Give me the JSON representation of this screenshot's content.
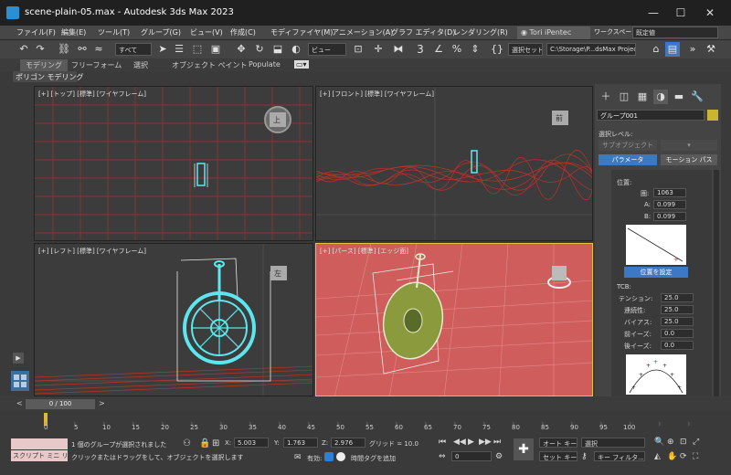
{
  "window": {
    "title": "scene-plain-05.max - Autodesk 3ds Max 2023",
    "min": "—",
    "max": "☐",
    "close": "✕"
  },
  "menu": {
    "items": [
      "ファイル(F)",
      "編集(E)",
      "ツール(T)",
      "グループ(G)",
      "ビュー(V)",
      "作成(C)",
      "モディファイヤ(M)",
      "アニメーション(A)",
      "グラフ エディタ(D)",
      "レンダリング(R)"
    ],
    "user": "Tori iPentec",
    "workspace_label": "ワークスペース:",
    "workspace_value": "既定値"
  },
  "toolbar": {
    "filter": "すべて",
    "view": "ビュー",
    "selset": "選択セット",
    "path": "C:\\Storage\\P...dsMax Project"
  },
  "ribbon": {
    "tabs": [
      "モデリング",
      "フリーフォーム",
      "選択",
      "オブジェクト ペイント",
      "Populate"
    ],
    "sub": "ポリゴン モデリング"
  },
  "viewports": {
    "top": "[+] [トップ] [標準] [ワイヤフレーム]",
    "front": "[+] [フロント] [標準] [ワイヤフレーム]",
    "left": "[+] [レフト] [標準] [ワイヤフレーム]",
    "persp": "[+] [パース] [標準] [エッジ面]",
    "cube_top": "上",
    "cube_front": "前",
    "cube_left": "左"
  },
  "cmd": {
    "object_name": "グループ001",
    "sel_level_label": "選択レベル:",
    "sub_object": "サブオブジェクト",
    "btn_param": "パラメータ",
    "btn_motion": "モーション パス",
    "pos_label": "位置:",
    "frame_label": "圏:",
    "frame_val": "1063",
    "a_label": "A:",
    "a_val": "0.099",
    "b_label": "B:",
    "b_val": "0.099",
    "set_pos": "位置を設定",
    "tcb_label": "TCB:",
    "tension_label": "テンション:",
    "tension": "25.0",
    "continuity_label": "連続性:",
    "continuity": "25.0",
    "bias_label": "バイアス:",
    "bias": "25.0",
    "ease_to_label": "前イーズ:",
    "ease_to": "0.0",
    "ease_from_label": "後イーズ:",
    "ease_from": "0.0"
  },
  "time": {
    "slider": "0 / 100",
    "ticks": [
      "0",
      "5",
      "10",
      "15",
      "20",
      "25",
      "30",
      "35",
      "40",
      "45",
      "50",
      "55",
      "60",
      "65",
      "70",
      "75",
      "80",
      "85",
      "90",
      "95",
      "100"
    ]
  },
  "status": {
    "maxscript": "スクリプト ミニ リス",
    "msg1": "1 個のグループが選択されました",
    "msg2": "クリックまたはドラッグをして、オブジェクトを選択します",
    "x_label": "X:",
    "x": "5.003",
    "y_label": "Y:",
    "y": "1.763",
    "z_label": "Z:",
    "z": "2.976",
    "grid": "グリッド = 10.0",
    "enabled": "有効:",
    "addtag": "時間タグを追加",
    "frame": "0",
    "autokey": "オート キー",
    "setkey": "セット キー",
    "sel": "選択",
    "keyfilter": "キー フィルタ..."
  },
  "colors": {
    "wire_red": "#c0302a",
    "wire_cyan": "#5ee6ef",
    "persp_bg": "#cf5d5c",
    "wheel_green": "#8a9a3c",
    "accent_blue": "#3d78c7"
  }
}
